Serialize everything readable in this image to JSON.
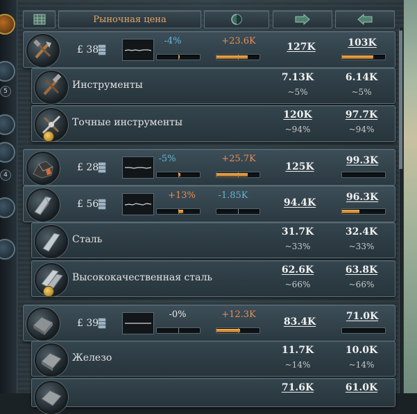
{
  "header": {
    "market_price_label": "Рыночная цена",
    "icons": [
      "table-view-icon",
      "clock-icon",
      "import-arrow-icon",
      "export-arrow-icon"
    ]
  },
  "currency_symbol": "£",
  "left_badges": [
    "5",
    "4"
  ],
  "groups": [
    {
      "icon": "tools-icon",
      "price": "38",
      "price_change": "-4%",
      "price_change_color": "blue",
      "balance": "+23.6K",
      "balance_color": "orange",
      "production": "127K",
      "consumption": "103K",
      "goods": [
        {
          "name": "Инструменты",
          "icon": "tools-icon",
          "production": "7.13K",
          "production_share": "~5%",
          "consumption": "6.14K",
          "consumption_share": "~5%",
          "medal": false
        },
        {
          "name": "Точные инструменты",
          "icon": "precision-tools-icon",
          "production": "120K",
          "production_share": "~94%",
          "consumption": "97.7K",
          "consumption_share": "~94%",
          "medal": true
        }
      ]
    },
    {
      "icon": "coal-icon",
      "price": "28",
      "price_change": "-5%",
      "price_change_color": "blue",
      "balance": "+25.7K",
      "balance_color": "orange",
      "production": "125K",
      "consumption": "99.3K",
      "goods": []
    },
    {
      "icon": "steel-beam-icon",
      "price": "56",
      "price_change": "+13%",
      "price_change_color": "orange",
      "balance": "-1.85K",
      "balance_color": "blue",
      "production": "94.4K",
      "consumption": "96.3K",
      "goods": [
        {
          "name": "Сталь",
          "icon": "steel-beam-icon",
          "production": "31.7K",
          "production_share": "~33%",
          "consumption": "32.4K",
          "consumption_share": "~33%",
          "medal": false
        },
        {
          "name": "Высококачественная сталь",
          "icon": "high-grade-steel-icon",
          "production": "62.6K",
          "production_share": "~66%",
          "consumption": "63.8K",
          "consumption_share": "~66%",
          "medal": true
        }
      ]
    },
    {
      "icon": "iron-ingot-icon",
      "price": "39",
      "price_change": "-0%",
      "price_change_color": "white",
      "balance": "+12.3K",
      "balance_color": "orange",
      "production": "83.4K",
      "consumption": "71.0K",
      "goods": [
        {
          "name": "Железо",
          "icon": "iron-ingot-icon",
          "production": "11.7K",
          "production_share": "~14%",
          "consumption": "10.0K",
          "consumption_share": "~14%",
          "medal": false
        },
        {
          "name": "",
          "icon": "iron-ingot-icon",
          "production": "71.6K",
          "production_share": "",
          "consumption": "61.0K",
          "consumption_share": "",
          "medal": true
        }
      ]
    }
  ],
  "levels": {
    "price_change": [
      0.08,
      0.1,
      0.24,
      0.0
    ],
    "balance": [
      0.72,
      0.72,
      0.0,
      0.55
    ],
    "consumption_bar": [
      0.72,
      0.0,
      0.4,
      0.0
    ]
  }
}
